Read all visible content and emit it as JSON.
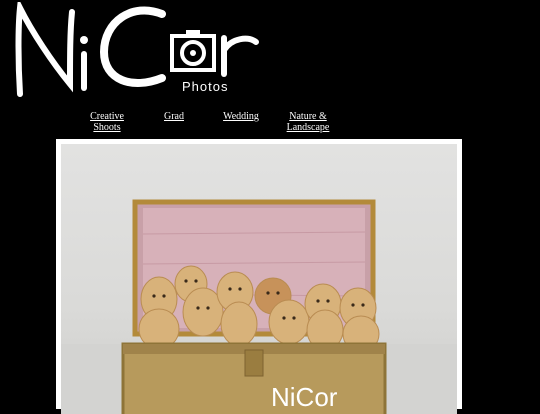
{
  "logo": {
    "brand": "NiCor",
    "sub": "Photos"
  },
  "nav": {
    "items": [
      {
        "label": "Creative Shoots"
      },
      {
        "label": "Grad"
      },
      {
        "label": "Wedding"
      },
      {
        "label": "Nature & Landscape"
      }
    ]
  },
  "photo": {
    "subject": "golden retriever puppies in a trunk",
    "watermark": "NiCor"
  }
}
